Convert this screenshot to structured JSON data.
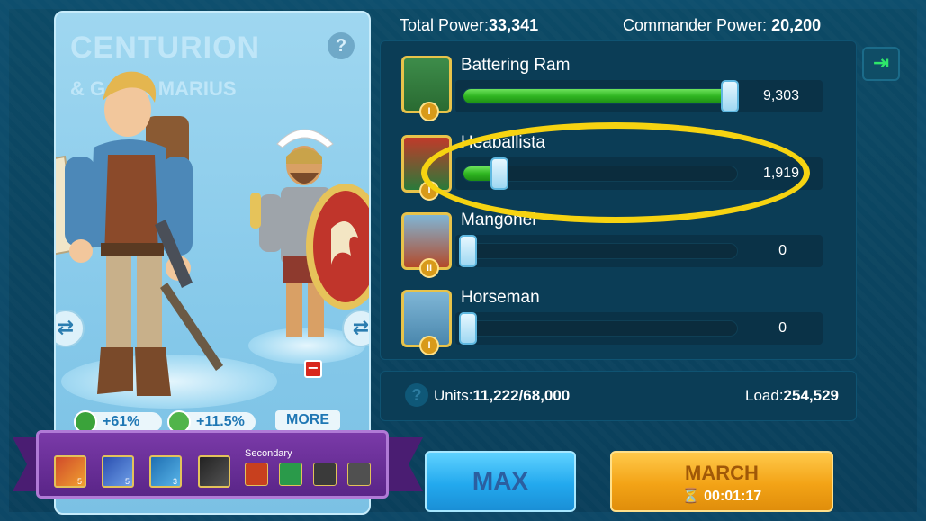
{
  "header": {
    "total_power_label": "Total Power:",
    "total_power_value": "33,341",
    "commander_power_label": "Commander Power:",
    "commander_power_value": "20,200"
  },
  "commander": {
    "primary_name": "CENTURION",
    "secondary_name": "& GAIUS MARIUS",
    "help_icon": "?",
    "remove_icon": "−",
    "stats": [
      {
        "icon": "pickaxe-icon",
        "value": "+61%"
      },
      {
        "icon": "speed-icon",
        "value": "+11.5%"
      }
    ],
    "more_label": "MORE",
    "secondary_label": "Secondary",
    "primary_skill_levels": [
      "5",
      "5",
      "3"
    ]
  },
  "troops": [
    {
      "name": "Battering Ram",
      "count": "9,303",
      "fill_fraction": 0.99,
      "tier": "I"
    },
    {
      "name": "Heaballista",
      "count": "1,919",
      "fill_fraction": 0.12,
      "tier": "I"
    },
    {
      "name": "Mangonel",
      "count": "0",
      "fill_fraction": 0.0,
      "tier": "II"
    },
    {
      "name": "Horseman",
      "count": "0",
      "fill_fraction": 0.0,
      "tier": "I"
    }
  ],
  "info": {
    "units_label": "Units:",
    "units_value": "11,222/68,000",
    "load_label": "Load:",
    "load_value": "254,529",
    "info_icon": "?"
  },
  "buttons": {
    "max_label": "MAX",
    "march_label": "MARCH",
    "march_time": "00:01:17"
  },
  "colors": {
    "highlight": "#f6d311",
    "slider_fill": "#2fb521",
    "march_button": "#f3a316",
    "max_button": "#23a9ee"
  }
}
